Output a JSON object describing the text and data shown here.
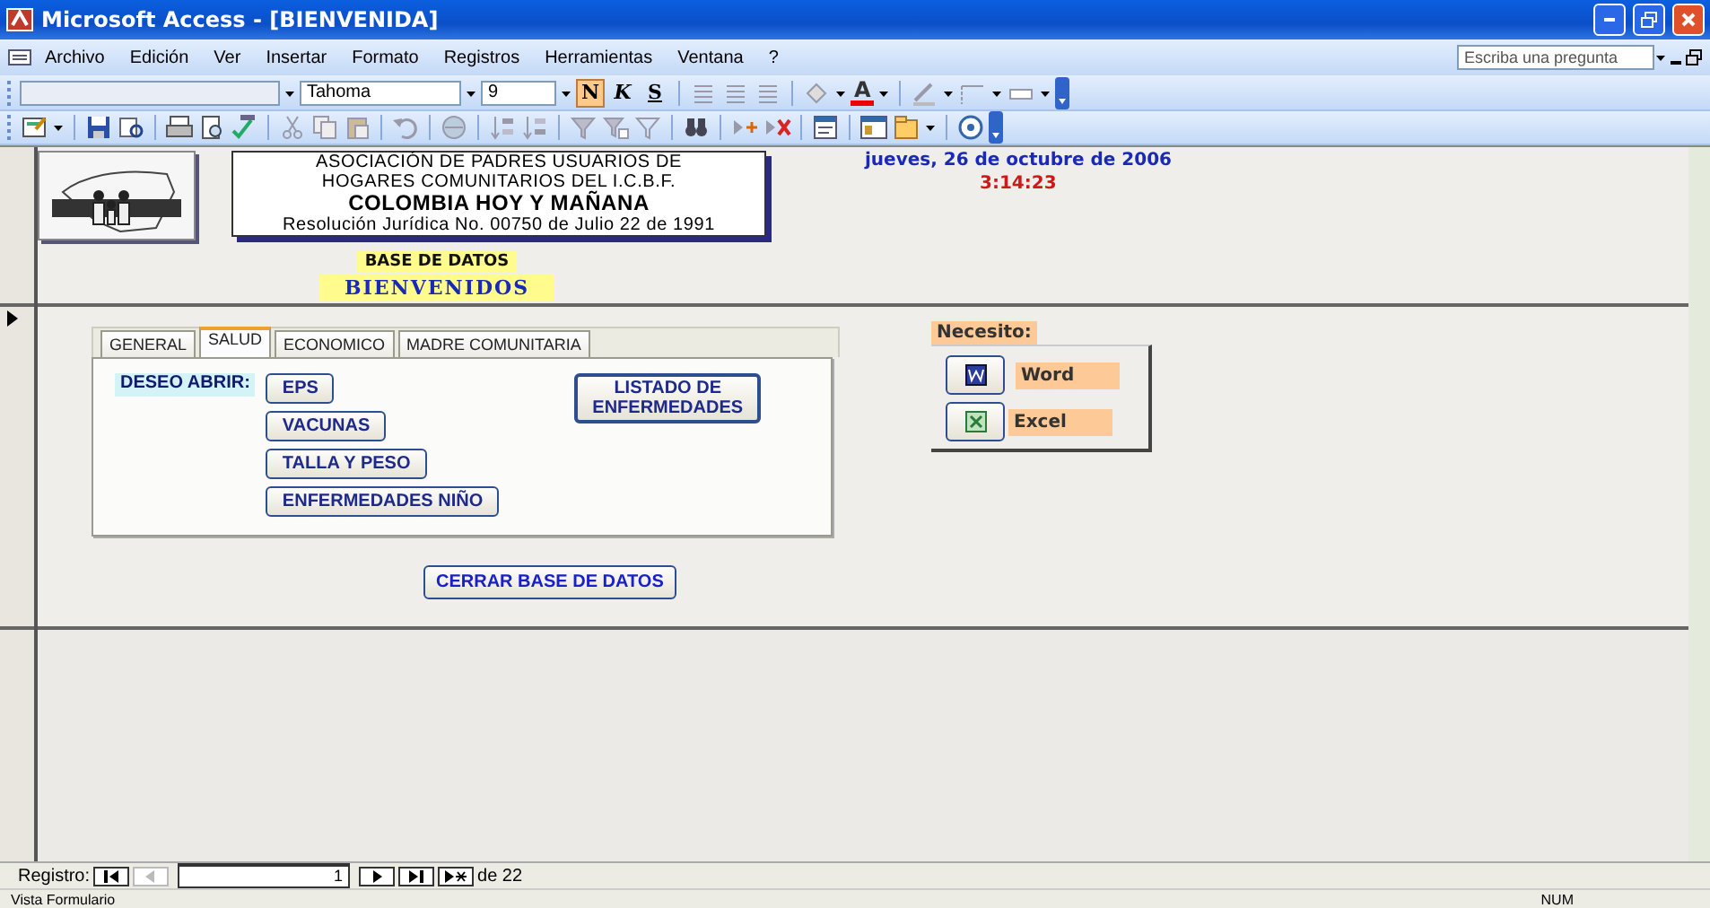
{
  "window": {
    "title": "Microsoft Access - [BIENVENIDA]"
  },
  "menu": [
    {
      "label": "Archivo"
    },
    {
      "label": "Edición"
    },
    {
      "label": "Ver"
    },
    {
      "label": "Insertar"
    },
    {
      "label": "Formato"
    },
    {
      "label": "Registros"
    },
    {
      "label": "Herramientas"
    },
    {
      "label": "Ventana"
    },
    {
      "label": "?"
    }
  ],
  "help_box": {
    "placeholder": "Escriba una pregunta"
  },
  "format_toolbar": {
    "font": "Tahoma",
    "size": "9",
    "font_color_label": "A",
    "style_buttons": [
      {
        "label": "N",
        "selected": true
      },
      {
        "label": "K",
        "selected": false
      },
      {
        "label": "S",
        "selected": false
      }
    ]
  },
  "header": {
    "org_lines": [
      "ASOCIACIÓN DE PADRES USUARIOS DE",
      "HOGARES COMUNITARIOS DEL I.C.B.F."
    ],
    "org_name": "COLOMBIA HOY Y MAÑANA",
    "resolution": "Resolución Jurídica No. 00750 de Julio 22 de 1991",
    "date": "jueves, 26 de octubre de 2006",
    "time": "3:14:23",
    "db_label": "BASE DE DATOS",
    "welcome": "BIENVENIDOS"
  },
  "tabs": [
    {
      "label": "GENERAL",
      "selected": false
    },
    {
      "label": "SALUD",
      "selected": true
    },
    {
      "label": "ECONOMICO",
      "selected": false
    },
    {
      "label": "MADRE COMUNITARIA",
      "selected": false
    }
  ],
  "tab_content": {
    "label": "DESEO ABRIR:",
    "buttons": [
      "EPS",
      "VACUNAS",
      "TALLA Y PESO",
      "ENFERMEDADES NIÑO"
    ],
    "side_button": "LISTADO DE ENFERMEDADES"
  },
  "needs": {
    "title": "Necesito:",
    "apps": [
      {
        "kind": "word",
        "label": "Word"
      },
      {
        "kind": "excel",
        "label": "Excel"
      }
    ]
  },
  "close_button": "CERRAR BASE DE DATOS",
  "navigation": {
    "label": "Registro:",
    "current": "1",
    "total": "de 22"
  },
  "status_bar": {
    "text": "Vista Formulario",
    "indicator": "NUM"
  }
}
